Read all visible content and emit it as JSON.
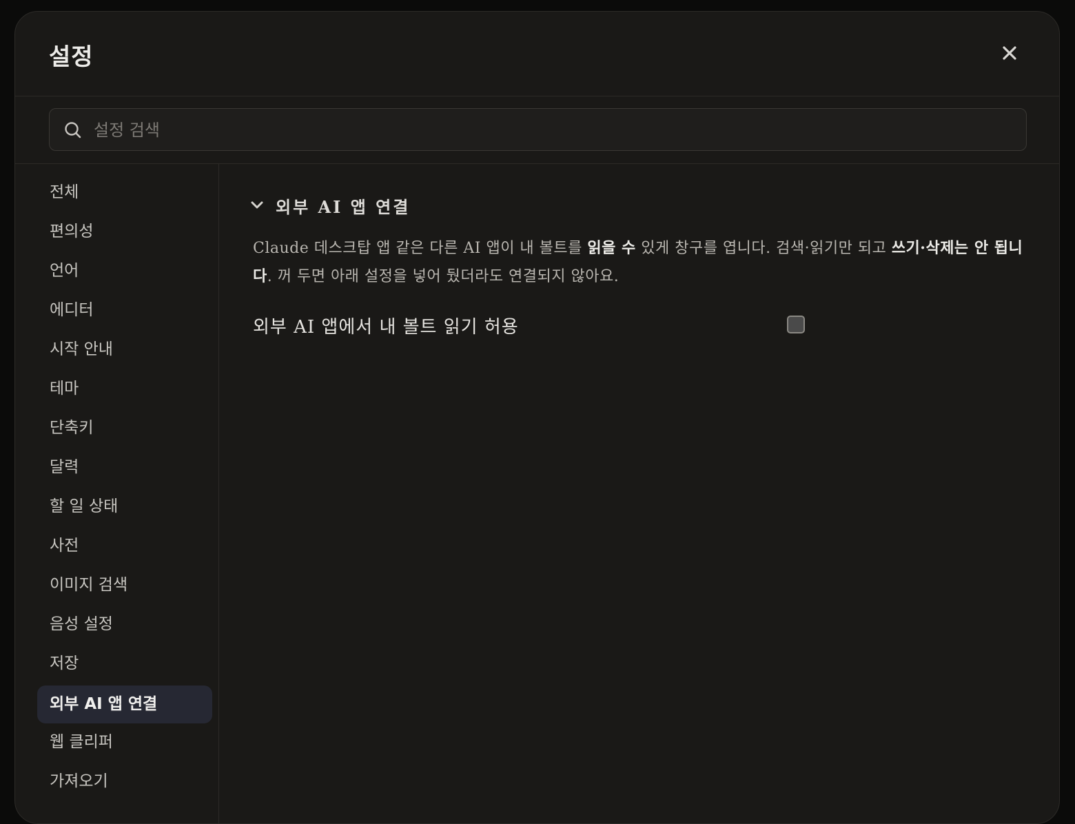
{
  "modal": {
    "title": "설정",
    "close_icon": "close-icon"
  },
  "search": {
    "placeholder": "설정 검색",
    "value": ""
  },
  "sidebar": {
    "items": [
      {
        "label": "전체",
        "active": false
      },
      {
        "label": "편의성",
        "active": false
      },
      {
        "label": "언어",
        "active": false
      },
      {
        "label": "에디터",
        "active": false
      },
      {
        "label": "시작 안내",
        "active": false
      },
      {
        "label": "테마",
        "active": false
      },
      {
        "label": "단축키",
        "active": false
      },
      {
        "label": "달력",
        "active": false
      },
      {
        "label": "할 일 상태",
        "active": false
      },
      {
        "label": "사전",
        "active": false
      },
      {
        "label": "이미지 검색",
        "active": false
      },
      {
        "label": "음성 설정",
        "active": false
      },
      {
        "label": "저장",
        "active": false
      },
      {
        "label": "외부 AI 앱 연결",
        "active": true
      },
      {
        "label": "웹 클리퍼",
        "active": false
      },
      {
        "label": "가져오기",
        "active": false
      }
    ]
  },
  "section": {
    "title": "외부 AI 앱 연결",
    "expanded": true,
    "description": {
      "part1": "Claude 데스크탑 앱 같은 다른 AI 앱이 내 볼트를 ",
      "bold1": "읽을 수",
      "part2": " 있게 창구를 엽니다. 검색·읽기만 되고 ",
      "bold2": "쓰기·삭제는 안 됩니다",
      "part3": ". 꺼 두면 아래 설정을 넣어 뒀더라도 연결되지 않아요."
    },
    "setting": {
      "label": "외부 AI 앱에서 내 볼트 읽기 허용",
      "checked": false
    }
  },
  "colors": {
    "background": "#1a1917",
    "active_item": "#262833",
    "text": "#e6e4e0"
  }
}
